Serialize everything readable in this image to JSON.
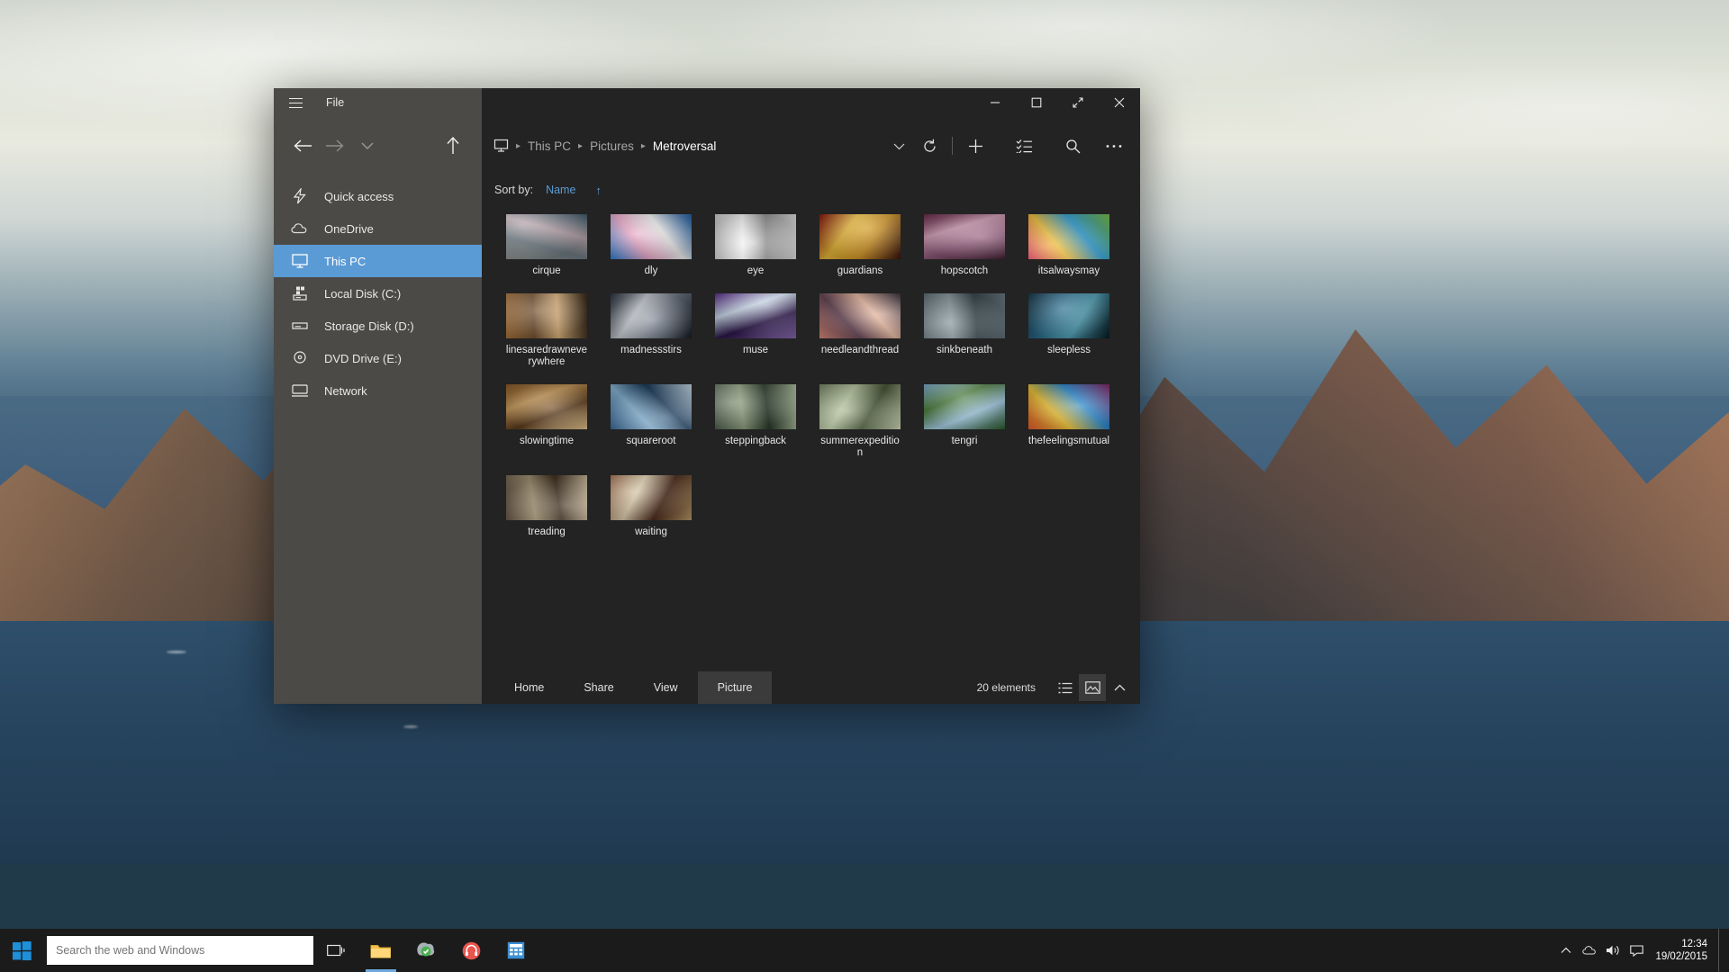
{
  "window": {
    "file_menu": "File",
    "hamburger_icon": "hamburger-menu-icon",
    "controls": {
      "minimize": "minimize-icon",
      "maximize": "maximize-icon",
      "restore_expand": "expand-icon",
      "close": "close-icon"
    }
  },
  "nav": {
    "back_icon": "back-arrow-icon",
    "forward_icon": "forward-arrow-icon",
    "recent_icon": "chevron-down-icon",
    "up_icon": "up-arrow-icon"
  },
  "sidebar": {
    "items": [
      {
        "label": "Quick access",
        "icon": "lightning-icon",
        "selected": false
      },
      {
        "label": "OneDrive",
        "icon": "cloud-icon",
        "selected": false
      },
      {
        "label": "This PC",
        "icon": "monitor-icon",
        "selected": true
      },
      {
        "label": "Local Disk (C:)",
        "icon": "hard-disk-icon",
        "selected": false
      },
      {
        "label": "Storage Disk (D:)",
        "icon": "drive-icon",
        "selected": false
      },
      {
        "label": "DVD Drive (E:)",
        "icon": "dvd-drive-icon",
        "selected": false
      },
      {
        "label": "Network",
        "icon": "network-icon",
        "selected": false
      }
    ]
  },
  "address": {
    "pc_icon": "this-pc-icon",
    "crumbs": [
      "This PC",
      "Pictures",
      "Metroversal"
    ],
    "separator": "▸",
    "history_icon": "chevron-down-icon",
    "refresh_icon": "refresh-icon",
    "new_icon": "plus-icon",
    "select_icon": "select-all-icon",
    "search_icon": "search-icon",
    "more_icon": "more-options-icon"
  },
  "sort": {
    "label": "Sort by:",
    "value": "Name",
    "direction_icon": "↑"
  },
  "files": [
    {
      "name": "cirque",
      "palette": [
        "#8a8f8c",
        "#6d7a82",
        "#b8a6ac",
        "#3d5a6b"
      ]
    },
    {
      "name": "dly",
      "palette": [
        "#2f7fd0",
        "#e8a5c4",
        "#f2f2f2",
        "#1d5fa8"
      ]
    },
    {
      "name": "eye",
      "palette": [
        "#cfcfcf",
        "#ffffff",
        "#9a9a9a",
        "#e3e3e3"
      ]
    },
    {
      "name": "guardians",
      "palette": [
        "#8b1a12",
        "#e8b83a",
        "#c98d1f",
        "#3a140f"
      ]
    },
    {
      "name": "hopscotch",
      "palette": [
        "#6b2c4a",
        "#d4a0b8",
        "#8f5a7a",
        "#3b1a2c"
      ]
    },
    {
      "name": "itsalwaysmay",
      "palette": [
        "#e23b5a",
        "#f2c13c",
        "#3aa9e0",
        "#7bc24a"
      ]
    },
    {
      "name": "linesaredrawneverywhere",
      "palette": [
        "#a8743c",
        "#6b4a2a",
        "#d8b07a",
        "#3a2a1c"
      ]
    },
    {
      "name": "madnessstirs",
      "palette": [
        "#2b3440",
        "#c8ccd2",
        "#6d7684",
        "#161c24"
      ]
    },
    {
      "name": "muse",
      "palette": [
        "#5b2d8a",
        "#c9d8e8",
        "#2a1548",
        "#8a6ab0"
      ]
    },
    {
      "name": "needleandthread",
      "palette": [
        "#d88a7a",
        "#6a4a5a",
        "#e8b8a0",
        "#2c2434"
      ]
    },
    {
      "name": "sinkbeneath",
      "palette": [
        "#5a6a70",
        "#8a9aa0",
        "#3a4a50",
        "#6a7a80"
      ]
    },
    {
      "name": "sleepless",
      "palette": [
        "#0d2a3a",
        "#2a6a8a",
        "#4a9ab0",
        "#061820"
      ]
    },
    {
      "name": "slowingtime",
      "palette": [
        "#8a5a2a",
        "#c89a5a",
        "#5a3a1a",
        "#e8c890"
      ]
    },
    {
      "name": "squareroot",
      "palette": [
        "#3a6a9a",
        "#8ab8d8",
        "#1a3a5a",
        "#c8dcea"
      ]
    },
    {
      "name": "steppingback",
      "palette": [
        "#4a5a4a",
        "#8a9a7a",
        "#2a3a2a",
        "#b8c8a8"
      ]
    },
    {
      "name": "summerexpedition",
      "palette": [
        "#7a8a6a",
        "#b8c8a0",
        "#4a5a3a",
        "#d8e0c0"
      ]
    },
    {
      "name": "tengri",
      "palette": [
        "#7aa8c8",
        "#4a7a3a",
        "#a8d0e8",
        "#2a5a2a"
      ]
    },
    {
      "name": "thefeelingsmutual",
      "palette": [
        "#e85a2a",
        "#f2c83a",
        "#2a8ad0",
        "#8a2a6a"
      ]
    },
    {
      "name": "treading",
      "palette": [
        "#6a5a4a",
        "#a89878",
        "#3a2a1a",
        "#c8b898"
      ]
    },
    {
      "name": "waiting",
      "palette": [
        "#8a5a3a",
        "#d8c8a8",
        "#4a2a1a",
        "#b89868"
      ]
    }
  ],
  "ribbon": {
    "tabs": [
      {
        "label": "Home",
        "active": false
      },
      {
        "label": "Share",
        "active": false
      },
      {
        "label": "View",
        "active": false
      },
      {
        "label": "Picture",
        "active": true
      }
    ]
  },
  "status": {
    "count": "20 elements",
    "details_view_icon": "details-view-icon",
    "thumbnail_view_icon": "thumbnail-view-icon",
    "expand_icon": "chevron-up-icon"
  },
  "taskbar": {
    "start_icon": "windows-start-icon",
    "search_placeholder": "Search the web and Windows",
    "search_value": "",
    "buttons": [
      {
        "name": "task-view-button",
        "icon": "task-view-icon",
        "running": false
      },
      {
        "name": "file-explorer-button",
        "icon": "folder-icon",
        "running": true
      },
      {
        "name": "store-button",
        "icon": "store-icon",
        "running": false
      },
      {
        "name": "music-button",
        "icon": "headphones-icon",
        "running": false
      },
      {
        "name": "calculator-button",
        "icon": "calculator-icon",
        "running": false
      }
    ],
    "tray": {
      "show_hidden_icon": "chevron-up-icon",
      "action_center_icon": "action-center-icon",
      "volume_icon": "volume-icon",
      "network_icon": "network-icon",
      "time": "12:34",
      "date": "19/02/2015"
    }
  },
  "colors": {
    "accent": "#5b9bd5",
    "sidebar_bg": "#4c4a47",
    "content_bg": "#232323",
    "tab_active_bg": "#3b3b3b"
  }
}
